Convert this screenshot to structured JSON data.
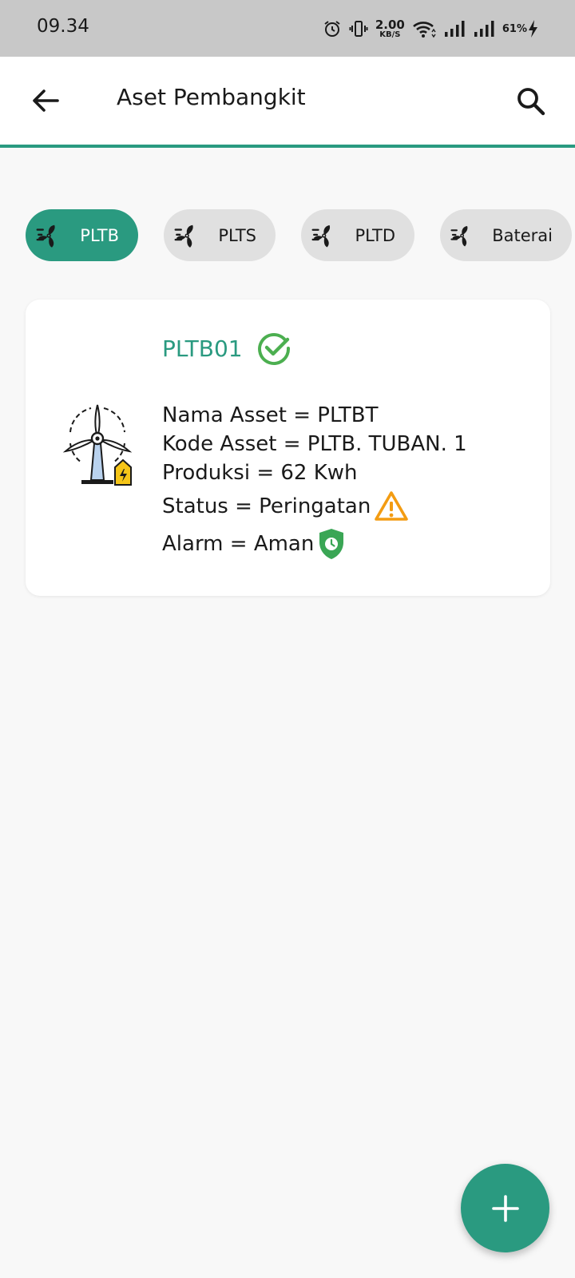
{
  "status_bar": {
    "time": "09.34",
    "net_speed_value": "2.00",
    "net_speed_unit": "KB/S",
    "battery": "61%",
    "icons": [
      "alarm-icon",
      "vibrate-icon",
      "wifi-icon",
      "signal-icon",
      "signal-icon",
      "charging-icon"
    ]
  },
  "app_bar": {
    "title": "Aset Pembangkit",
    "back_icon": "arrow-left-icon",
    "search_icon": "search-icon"
  },
  "chips": [
    {
      "label": "PLTB",
      "selected": true
    },
    {
      "label": "PLTS",
      "selected": false
    },
    {
      "label": "PLTD",
      "selected": false
    },
    {
      "label": "Baterai",
      "selected": false
    }
  ],
  "card": {
    "title": "PLTB01",
    "title_icon": "check-circle-icon",
    "image_icon": "wind-turbine-icon",
    "nama_asset": "Nama Asset = PLTBT",
    "kode_asset": "Kode Asset = PLTB. TUBAN. 1",
    "produksi": "Produksi = 62 Kwh",
    "status": "Status = Peringatan",
    "status_icon": "warning-icon",
    "alarm": "Alarm = Aman",
    "alarm_icon": "shield-clock-icon"
  },
  "fab": {
    "icon": "plus-icon"
  },
  "colors": {
    "primary": "#2a9a80",
    "status_bar_bg": "#c8c8c8",
    "chip_bg": "#e0e0e0",
    "check_green": "#4caf50",
    "warning_orange": "#f39c12",
    "shield_green": "#3aa655",
    "background": "#f8f8f8"
  }
}
